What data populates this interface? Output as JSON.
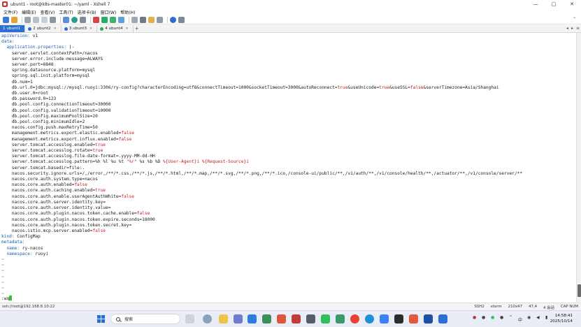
{
  "window": {
    "title": "ubunt1 - root@k8s-master01: ~/yaml - Xshell 7",
    "controls": [
      "—",
      "□",
      "✕"
    ]
  },
  "menu": [
    "文件(F)",
    "编辑(E)",
    "查看(V)",
    "工具(T)",
    "选项卡(B)",
    "窗口(W)",
    "帮助(H)"
  ],
  "tabs": [
    {
      "label": "1 ubunt1",
      "active": true,
      "dot_color": "#ffffff"
    },
    {
      "label": "2 ubunt2",
      "active": false,
      "dot_color": "#2c6fd1"
    },
    {
      "label": "3 ubunt3",
      "active": false,
      "dot_color": "#2c6fd1"
    },
    {
      "label": "4 ubunt4",
      "active": false,
      "dot_color": "#2aa84a"
    }
  ],
  "terminal": {
    "lines": [
      [
        [
          "k",
          "apiVersion:"
        ],
        [
          "t",
          " v1"
        ]
      ],
      [
        [
          "k",
          "data:"
        ]
      ],
      [
        [
          "k",
          "  application.properties:"
        ],
        [
          "t",
          " |-"
        ]
      ],
      [
        [
          "t",
          "    server.servlet.contextPath=/nacos"
        ]
      ],
      [
        [
          "t",
          "    server.error.include-message=ALWAYS"
        ]
      ],
      [
        [
          "t",
          "    server.port=8848"
        ]
      ],
      [
        [
          "t",
          "    spring.datasource.platform=mysql"
        ]
      ],
      [
        [
          "t",
          "    spring.sql.init.platform=mysql"
        ]
      ],
      [
        [
          "t",
          "    db.num=1"
        ]
      ],
      [
        [
          "t",
          "    db.url.0=jdbc:mysql://mysql.ruoyi:3306/ry-config?characterEncoding=utf8&connectTimeout=1000&socketTimeout=3000&autoReconnect="
        ],
        [
          "v",
          "true"
        ],
        [
          "t",
          "&useUnicode="
        ],
        [
          "v",
          "true"
        ],
        [
          "t",
          "&useSSL="
        ],
        [
          "v",
          "false"
        ],
        [
          "t",
          "&serverTimezone=Asia/Shanghai"
        ]
      ],
      [
        [
          "t",
          "    db.user.0=root"
        ]
      ],
      [
        [
          "t",
          "    db.password.0=123"
        ]
      ],
      [
        [
          "t",
          "    db.pool.config.connectionTimeout=30000"
        ]
      ],
      [
        [
          "t",
          "    db.pool.config.validationTimeout=10000"
        ]
      ],
      [
        [
          "t",
          "    db.pool.config.maximumPoolSize=20"
        ]
      ],
      [
        [
          "t",
          "    db.pool.config.minimumIdle=2"
        ]
      ],
      [
        [
          "t",
          "    nacos.config.push.maxRetryTime=50"
        ]
      ],
      [
        [
          "t",
          "    management.metrics.export.elastic.enabled="
        ],
        [
          "v",
          "false"
        ]
      ],
      [
        [
          "t",
          "    management.metrics.export.influx.enabled="
        ],
        [
          "v",
          "false"
        ]
      ],
      [
        [
          "t",
          "    server.tomcat.accesslog.enabled="
        ],
        [
          "v",
          "true"
        ]
      ],
      [
        [
          "t",
          "    server.tomcat.accesslog.rotate="
        ],
        [
          "v",
          "true"
        ]
      ],
      [
        [
          "t",
          "    server.tomcat.accesslog.file-date-format=.yyyy-MM-dd-HH"
        ]
      ],
      [
        [
          "t",
          "    server.tomcat.accesslog.pattern=%h %l %u %t "
        ],
        [
          "v",
          "\"%r\""
        ],
        [
          "t",
          " %s %b %D "
        ],
        [
          "v",
          "%{User-Agent}i"
        ],
        [
          "t",
          " "
        ],
        [
          "v",
          "%{Request-Source}i"
        ]
      ],
      [
        [
          "t",
          "    server.tomcat.basedir=file:."
        ]
      ],
      [
        [
          "t",
          "    nacos.security.ignore.urls=/,/error,/**/*.css,/**/*.js,/**/*.html,/**/*.map,/**/*.svg,/**/*.png,/**/*.ico,/console-ui/public/**,/v1/auth/**,/v1/console/health/**,/actuator/**,/v1/console/server/**"
        ]
      ],
      [
        [
          "t",
          "    nacos.core.auth.system.type=nacos"
        ]
      ],
      [
        [
          "t",
          "    nacos.core.auth.enabled="
        ],
        [
          "v",
          "false"
        ]
      ],
      [
        [
          "t",
          "    nacos.core.auth.caching.enabled="
        ],
        [
          "v",
          "true"
        ]
      ],
      [
        [
          "t",
          "    nacos.core.auth.enable.userAgentAuthWhite="
        ],
        [
          "v",
          "false"
        ]
      ],
      [
        [
          "t",
          "    nacos.core.auth.server.identity.key="
        ]
      ],
      [
        [
          "t",
          "    nacos.core.auth.server.identity.value="
        ]
      ],
      [
        [
          "t",
          "    nacos.core.auth.plugin.nacos.token.cache.enable="
        ],
        [
          "v",
          "false"
        ]
      ],
      [
        [
          "t",
          "    nacos.core.auth.plugin.nacos.token.expire.seconds=18000"
        ]
      ],
      [
        [
          "t",
          "    nacos.core.auth.plugin.nacos.token.secret.key="
        ]
      ],
      [
        [
          "t",
          "    nacos.istio.mcp.server.enabled="
        ],
        [
          "v",
          "false"
        ]
      ],
      [
        [
          "k",
          "kind:"
        ],
        [
          "t",
          " ConfigMap"
        ]
      ],
      [
        [
          "k",
          "metadata:"
        ]
      ],
      [
        [
          "k",
          "  name:"
        ],
        [
          "t",
          " ry-nacos"
        ]
      ],
      [
        [
          "k",
          "  namespace:"
        ],
        [
          "t",
          " ruoyi"
        ]
      ],
      [
        [
          "tilde",
          "~"
        ]
      ],
      [
        [
          "tilde",
          "~"
        ]
      ],
      [
        [
          "tilde",
          "~"
        ]
      ],
      [
        [
          "tilde",
          "~"
        ]
      ],
      [
        [
          "tilde",
          "~"
        ]
      ],
      [
        [
          "tilde",
          "~"
        ]
      ],
      [
        [
          "tilde",
          "~"
        ]
      ]
    ],
    "command": ":wq"
  },
  "status": {
    "host": "ssh://root@192.168.8.10:22",
    "protocol": "SSH2",
    "term": "xterm",
    "size": "210x47",
    "cursor": "47,4",
    "sessions": "4 会话",
    "caps": "CAP NUM"
  },
  "taskbar": {
    "search_placeholder": "搜索",
    "time": "14:58:41",
    "date": "2025/10/14",
    "lang": "中"
  }
}
